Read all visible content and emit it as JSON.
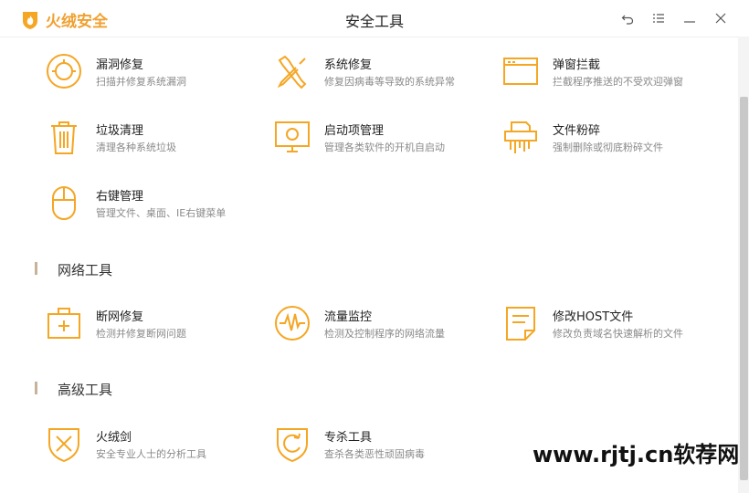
{
  "app": {
    "logo_text": "火绒安全",
    "window_title": "安全工具"
  },
  "colors": {
    "accent": "#f5a623",
    "section_bar": "#c9b29a"
  },
  "window_buttons": [
    "back-icon",
    "menu-icon",
    "minimize-icon",
    "close-icon"
  ],
  "tools_top": [
    {
      "name": "漏洞修复",
      "desc": "扫描并修复系统漏洞",
      "icon": "vulnerability-repair-icon"
    },
    {
      "name": "系统修复",
      "desc": "修复因病毒等导致的系统异常",
      "icon": "system-repair-icon"
    },
    {
      "name": "弹窗拦截",
      "desc": "拦截程序推送的不受欢迎弹窗",
      "icon": "popup-block-icon"
    },
    {
      "name": "垃圾清理",
      "desc": "清理各种系统垃圾",
      "icon": "trash-icon"
    },
    {
      "name": "启动项管理",
      "desc": "管理各类软件的开机自启动",
      "icon": "startup-manager-icon"
    },
    {
      "name": "文件粉碎",
      "desc": "强制删除或彻底粉碎文件",
      "icon": "file-shredder-icon"
    },
    {
      "name": "右键管理",
      "desc": "管理文件、桌面、IE右键菜单",
      "icon": "mouse-icon"
    }
  ],
  "network_section": {
    "title": "网络工具",
    "tools": [
      {
        "name": "断网修复",
        "desc": "检测并修复断网问题",
        "icon": "network-repair-icon"
      },
      {
        "name": "流量监控",
        "desc": "检测及控制程序的网络流量",
        "icon": "traffic-monitor-icon"
      },
      {
        "name": "修改HOST文件",
        "desc": "修改负责域名快速解析的文件",
        "icon": "host-file-icon"
      }
    ]
  },
  "advanced_section": {
    "title": "高级工具",
    "tools": [
      {
        "name": "火绒剑",
        "desc": "安全专业人士的分析工具",
        "icon": "huorong-sword-icon"
      },
      {
        "name": "专杀工具",
        "desc": "查杀各类恶性顽固病毒",
        "icon": "virus-killer-icon"
      }
    ]
  },
  "watermark": "www.rjtj.cn软荐网"
}
